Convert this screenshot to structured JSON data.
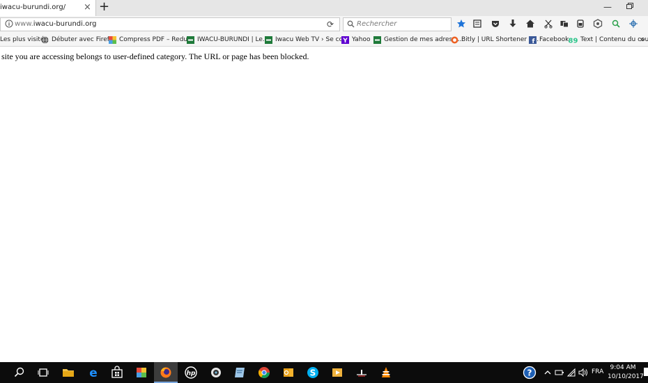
{
  "browser": {
    "tab": {
      "title": "iwacu-burundi.org/",
      "close_glyph": "×"
    },
    "new_tab_glyph": "+",
    "window_controls": {
      "minimize_glyph": "—"
    },
    "urlbar": {
      "prefix": "www.",
      "domain": "iwacu-burundi.org"
    },
    "searchbar": {
      "placeholder": "Rechercher"
    },
    "toolbar_icons": [
      "bookmark-star-icon",
      "reading-list-icon",
      "pocket-icon",
      "download-icon",
      "home-icon",
      "screenshot-icon",
      "extension-icon",
      "extension-icon",
      "extension-icon",
      "search-extension-icon",
      "extension-icon"
    ],
    "bookmarks": [
      {
        "label": "Les plus visités",
        "icon": "gear-icon"
      },
      {
        "label": "Débuter avec Firefox",
        "icon": "globe-icon"
      },
      {
        "label": "Compress PDF – Redu...",
        "icon": "pdf-icon"
      },
      {
        "label": "IWACU-BURUNDI | Le...",
        "icon": "iwacu-icon"
      },
      {
        "label": "Iwacu Web TV › Se co...",
        "icon": "iwacu-icon"
      },
      {
        "label": "Yahoo",
        "icon": "yahoo-icon"
      },
      {
        "label": "Gestion de mes adress...",
        "icon": "iwacu-icon"
      },
      {
        "label": "Bitly | URL Shortener a...",
        "icon": "bitly-icon"
      },
      {
        "label": "Facebook",
        "icon": "facebook-icon"
      },
      {
        "label": "Text | Contenu du cou...",
        "icon": "text-icon"
      }
    ],
    "bookmarks_more": "»"
  },
  "page": {
    "message": "site you are accessing belongs to user-defined category. The URL or page has been blocked."
  },
  "taskbar": {
    "apps": [
      "search-icon",
      "task-view-icon",
      "file-explorer-icon",
      "edge-icon",
      "store-icon",
      "photos-icon",
      "firefox-icon",
      "hp-icon",
      "camera-icon",
      "notes-icon",
      "chrome-icon",
      "outlook-icon",
      "skype-icon",
      "media-player-icon",
      "app-icon",
      "vlc-icon"
    ],
    "tray": {
      "language": "FRA",
      "time": "9:04 AM",
      "date": "10/10/2017"
    }
  },
  "colors": {
    "accent": "#0a84ff",
    "taskbar": "#0c0c0c"
  }
}
